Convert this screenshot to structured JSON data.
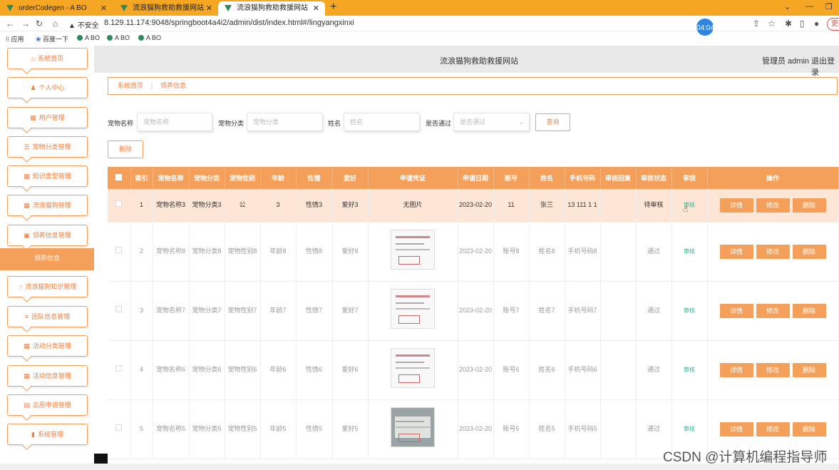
{
  "browser": {
    "tabs": [
      {
        "title": "orderCodegen - A BO"
      },
      {
        "title": "流浪猫狗救助救援网站"
      },
      {
        "title": "流浪猫狗救助救援网站"
      }
    ],
    "security_label": "不安全",
    "url": "8.129.11.174:9048/springboot4a4i2/admin/dist/index.html#/lingyangxinxi",
    "timer": "04:04",
    "update_label": "更新",
    "bookmarks": [
      "应用",
      "百度一下",
      "A BO",
      "A BO",
      "A BO"
    ]
  },
  "sidebar": {
    "items": [
      {
        "label": "系统首页",
        "icon": "home-icon"
      },
      {
        "label": "个人中心",
        "icon": "user-icon"
      },
      {
        "label": "用户管理",
        "icon": "grid-icon"
      },
      {
        "label": "宠物分类管理",
        "icon": "list-icon"
      },
      {
        "label": "知识类型管理",
        "icon": "grid-icon"
      },
      {
        "label": "流浪猫狗管理",
        "icon": "grid-icon"
      },
      {
        "label": "领养信息管理",
        "icon": "ticket-icon"
      },
      {
        "label": "领养信息",
        "icon": ""
      },
      {
        "label": "流浪猫狗知识管理",
        "icon": "thumb-icon"
      },
      {
        "label": "团队信息管理",
        "icon": "sliders-icon"
      },
      {
        "label": "活动分类管理",
        "icon": "grid-icon"
      },
      {
        "label": "活动信息管理",
        "icon": "grid-icon"
      },
      {
        "label": "志愿申请管理",
        "icon": "briefcase-icon"
      },
      {
        "label": "系统管理",
        "icon": "bar-chart-icon"
      }
    ]
  },
  "header": {
    "title": "流浪猫狗救助救援网站",
    "admin": "管理员 admin",
    "logout": "退出登录"
  },
  "breadcrumb": {
    "home": "系统首页",
    "current": "领养信息"
  },
  "filters": {
    "pet_name_label": "宠物名称",
    "pet_name_placeholder": "宠物名称",
    "pet_category_label": "宠物分类",
    "pet_category_placeholder": "宠物分类",
    "name_label": "姓名",
    "name_placeholder": "姓名",
    "approved_label": "是否通过",
    "approved_placeholder": "是否通过",
    "query_button": "查询",
    "delete_button": "删除"
  },
  "table": {
    "headers": [
      "",
      "索引",
      "宠物名称",
      "宠物分类",
      "宠物性别",
      "年龄",
      "性情",
      "爱好",
      "申请凭证",
      "申请日期",
      "账号",
      "姓名",
      "手机号码",
      "审核回复",
      "审核状态",
      "审核",
      "操作"
    ],
    "actions": {
      "detail": "详情",
      "edit": "修改",
      "delete": "删除"
    },
    "audit_label": "审核",
    "rows": [
      {
        "index": "1",
        "pet_name": "宠物名称3",
        "category": "宠物分类3",
        "gender": "公",
        "age": "3",
        "temper": "性情3",
        "hobby": "爱好3",
        "proof": "无图片",
        "date": "2023-02-20",
        "account": "11",
        "name": "张三",
        "phone": "13 111 1 1",
        "reply": "",
        "status": "待审核"
      },
      {
        "index": "2",
        "pet_name": "宠物名称8",
        "category": "宠物分类8",
        "gender": "宠物性别8",
        "age": "年龄8",
        "temper": "性情8",
        "hobby": "爱好8",
        "proof": "image",
        "date": "2023-02-20",
        "account": "账号8",
        "name": "姓名8",
        "phone": "手机号码8",
        "reply": "",
        "status": "通过"
      },
      {
        "index": "3",
        "pet_name": "宠物名称7",
        "category": "宠物分类7",
        "gender": "宠物性别7",
        "age": "年龄7",
        "temper": "性情7",
        "hobby": "爱好7",
        "proof": "image",
        "date": "2023-02-20",
        "account": "账号7",
        "name": "姓名7",
        "phone": "手机号码7",
        "reply": "",
        "status": "通过"
      },
      {
        "index": "4",
        "pet_name": "宠物名称6",
        "category": "宠物分类6",
        "gender": "宠物性别6",
        "age": "年龄6",
        "temper": "性情6",
        "hobby": "爱好6",
        "proof": "image",
        "date": "2023-02-20",
        "account": "账号6",
        "name": "姓名6",
        "phone": "手机号码6",
        "reply": "",
        "status": "通过"
      },
      {
        "index": "5",
        "pet_name": "宠物名称5",
        "category": "宠物分类5",
        "gender": "宠物性别5",
        "age": "年龄5",
        "temper": "性情5",
        "hobby": "爱好5",
        "proof": "photo",
        "date": "2023-02-20",
        "account": "账号5",
        "name": "姓名5",
        "phone": "手机号码5",
        "reply": "",
        "status": "通过"
      }
    ]
  },
  "watermark": "CSDN @计算机编程指导师"
}
